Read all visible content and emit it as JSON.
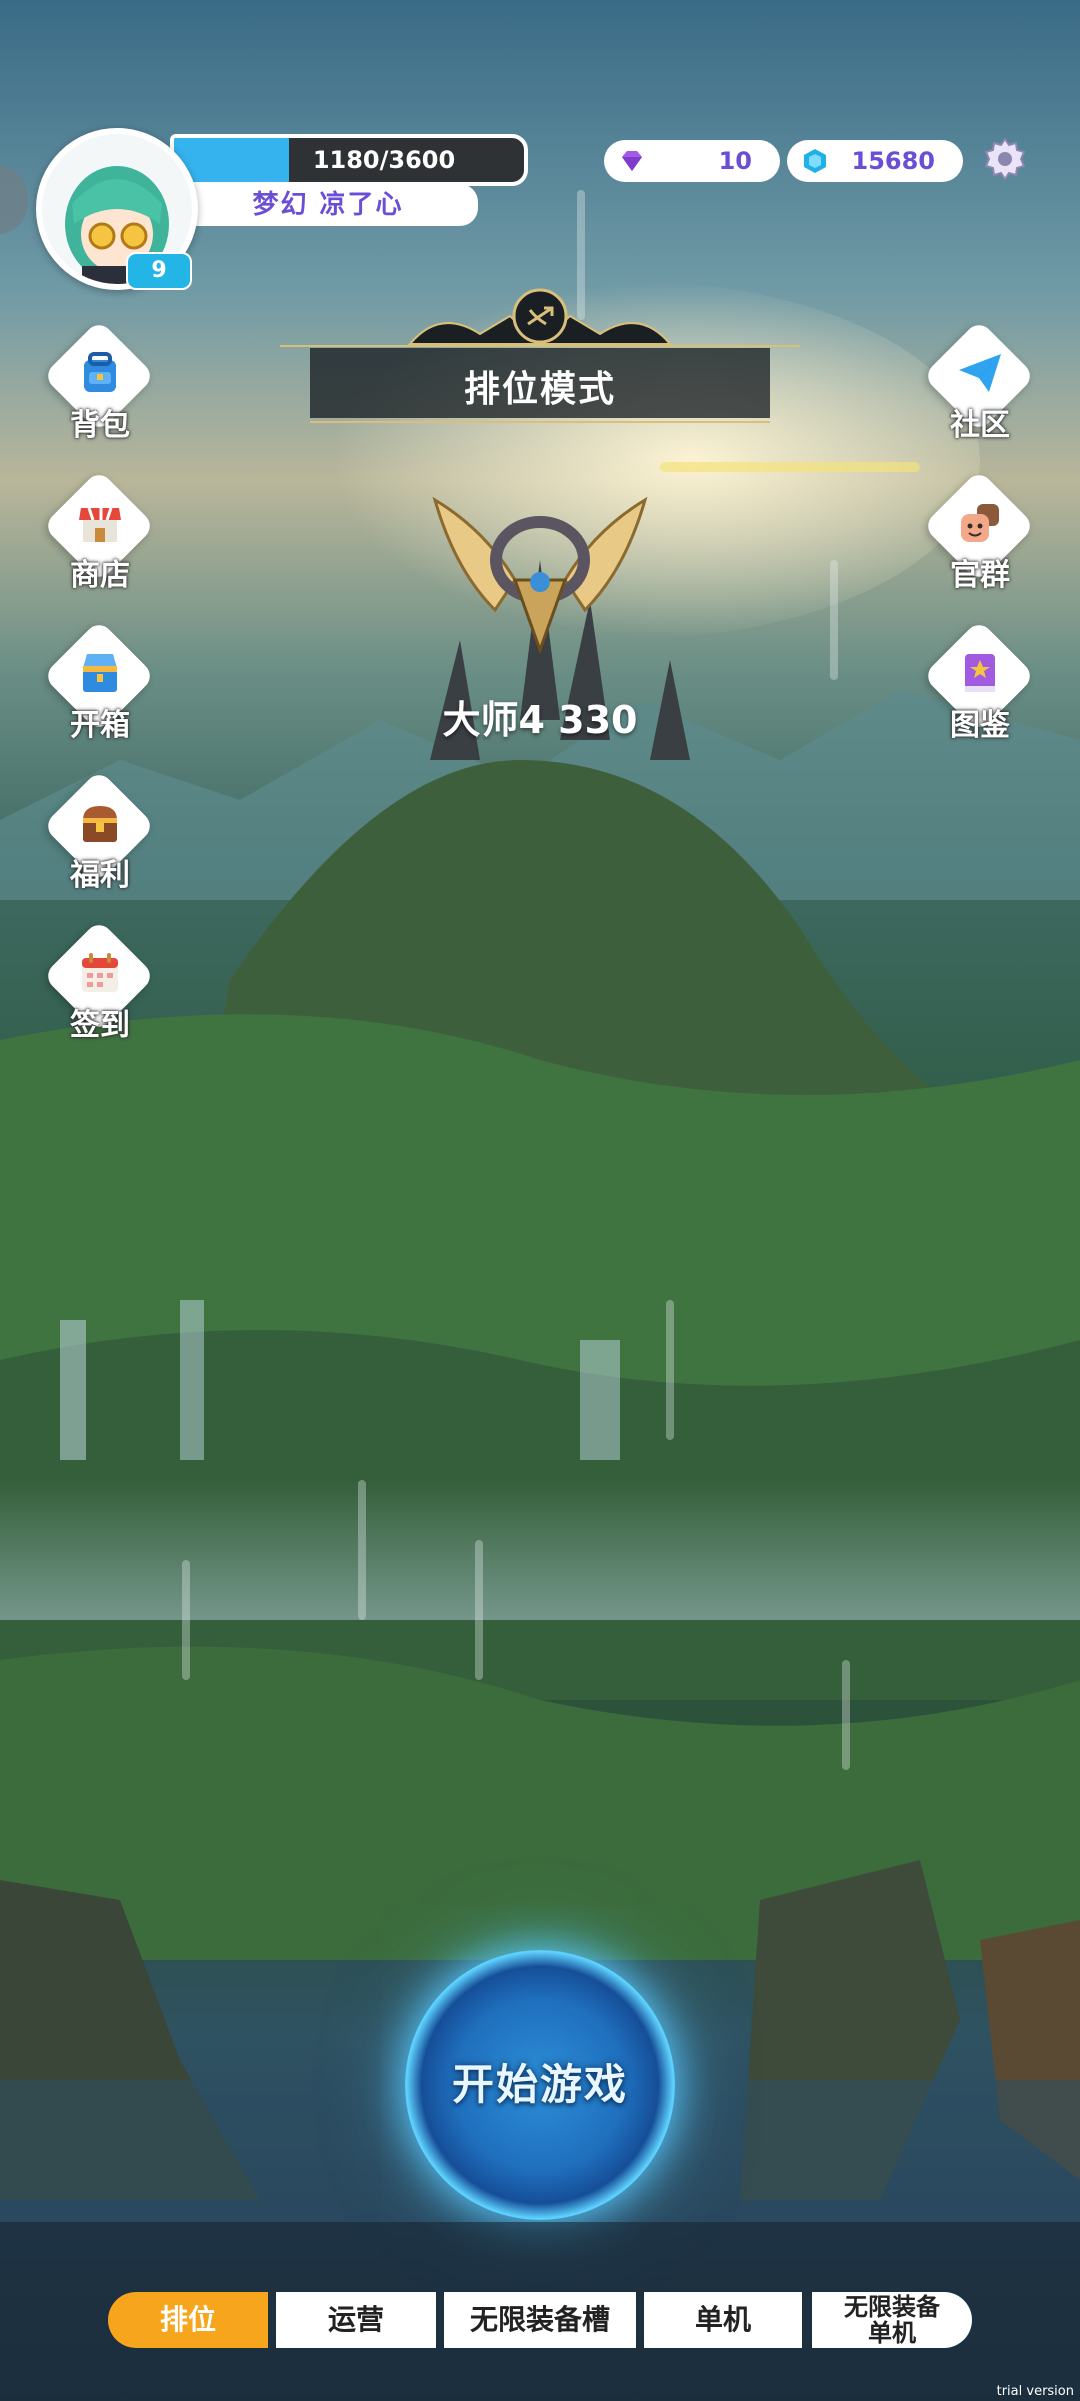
{
  "header": {
    "exp_text": "1180/3600",
    "exp_fraction": 0.3278,
    "player_name": "梦幻  凉了心",
    "level": "9",
    "diamonds": "10",
    "gems": "15680",
    "diamond_icon": "purple-diamond-icon",
    "gem_icon": "blue-hexagon-gem-icon",
    "settings_icon": "gear-icon"
  },
  "mode": {
    "title": "排位模式",
    "rank": "大师4 330"
  },
  "left_menu": [
    {
      "label": "背包",
      "icon": "backpack-icon"
    },
    {
      "label": "商店",
      "icon": "shop-icon"
    },
    {
      "label": "开箱",
      "icon": "chest-open-icon"
    },
    {
      "label": "福利",
      "icon": "treasure-chest-icon"
    },
    {
      "label": "签到",
      "icon": "calendar-icon"
    }
  ],
  "right_menu": [
    {
      "label": "社区",
      "icon": "paper-plane-icon"
    },
    {
      "label": "官群",
      "icon": "group-faces-icon"
    },
    {
      "label": "图鉴",
      "icon": "book-star-icon"
    }
  ],
  "start_button": "开始游戏",
  "tabs": [
    {
      "label": "排位",
      "active": true
    },
    {
      "label": "运营",
      "active": false
    },
    {
      "label": "无限装备槽",
      "active": false
    },
    {
      "label": "单机",
      "active": false
    },
    {
      "label": "无限装备\n单机",
      "active": false
    }
  ],
  "watermark": "trial version",
  "colors": {
    "accent_orange": "#f7a51d",
    "exp_blue": "#35b3ef",
    "name_purple": "#6a4fd6"
  }
}
